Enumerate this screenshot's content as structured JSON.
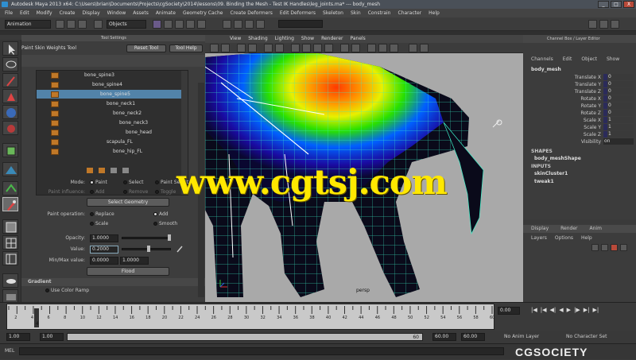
{
  "window": {
    "title": "Autodesk Maya 2013 x64: C:\\Users\\brian\\Documents\\Projects\\cgSociety\\2014\\lessons\\09. Binding the Mesh - Test IK Handles\\leg_joints.ma* --- body_mesh",
    "buttons": [
      "_",
      "□",
      "X"
    ]
  },
  "menubar": [
    "File",
    "Edit",
    "Modify",
    "Create",
    "Display",
    "Window",
    "Assets",
    "Animate",
    "Geometry Cache",
    "Create Deformers",
    "Edit Deformers",
    "Skeleton",
    "Skin",
    "Constrain",
    "Character",
    "Help"
  ],
  "shelf": {
    "mode": "Animation",
    "objects_combo": "Objects"
  },
  "tool_settings": {
    "header": "Tool Settings",
    "tool_name": "Paint Skin Weights Tool",
    "reset_button": "Reset Tool",
    "help_button": "Tool Help",
    "joints": [
      {
        "name": "bone_spine3",
        "indent": 60
      },
      {
        "name": "bone_spine4",
        "indent": 70
      },
      {
        "name": "bone_spine5",
        "indent": 80,
        "selected": true
      },
      {
        "name": "bone_neck1",
        "indent": 88
      },
      {
        "name": "bone_neck2",
        "indent": 96
      },
      {
        "name": "bone_neck3",
        "indent": 104
      },
      {
        "name": "bone_head",
        "indent": 112
      },
      {
        "name": "scapula_FL",
        "indent": 88
      },
      {
        "name": "bone_hip_FL",
        "indent": 96
      }
    ],
    "mode_label": "Mode:",
    "mode_options": [
      "Paint",
      "Select",
      "Paint Select"
    ],
    "paint_influence_label": "Paint influence:",
    "paint_influence_options": [
      "Add",
      "Remove",
      "Toggle"
    ],
    "select_geometry_button": "Select Geometry",
    "paint_operation_label": "Paint operation:",
    "paint_operations": [
      "Replace",
      "Add",
      "Scale",
      "Smooth"
    ],
    "opacity_label": "Opacity:",
    "opacity_value": "1.0000",
    "value_label": "Value:",
    "value_value": "0.2000",
    "minmax_label": "Min/Max value:",
    "min_value": "0.0000",
    "max_value": "1.0000",
    "flood_button": "Flood",
    "gradient_section": "Gradient",
    "use_color_ramp": "Use Color Ramp"
  },
  "viewport": {
    "menu": [
      "View",
      "Shading",
      "Lighting",
      "Show",
      "Renderer",
      "Panels"
    ],
    "camera_label": "persp"
  },
  "channel_box": {
    "header": "Channel Box / Layer Editor",
    "tabs": [
      "Channels",
      "Edit",
      "Object",
      "Show"
    ],
    "object_name": "body_mesh",
    "attributes": [
      {
        "name": "Translate X",
        "value": "0"
      },
      {
        "name": "Translate Y",
        "value": "0"
      },
      {
        "name": "Translate Z",
        "value": "0"
      },
      {
        "name": "Rotate X",
        "value": "0"
      },
      {
        "name": "Rotate Y",
        "value": "0"
      },
      {
        "name": "Rotate Z",
        "value": "0"
      },
      {
        "name": "Scale X",
        "value": "1"
      },
      {
        "name": "Scale Y",
        "value": "1"
      },
      {
        "name": "Scale Z",
        "value": "1"
      },
      {
        "name": "Visibility",
        "value": "on"
      }
    ],
    "shapes_header": "SHAPES",
    "shape_name": "body_meshShape",
    "inputs_header": "INPUTS",
    "inputs": [
      "skinCluster1",
      "tweak1"
    ]
  },
  "layer_editor": {
    "tabs": [
      "Display",
      "Render",
      "Anim"
    ],
    "menu": [
      "Layers",
      "Options",
      "Help"
    ]
  },
  "timeline": {
    "ticks": [
      "2",
      "4",
      "6",
      "8",
      "10",
      "12",
      "14",
      "16",
      "18",
      "20",
      "22",
      "24",
      "26",
      "28",
      "30",
      "32",
      "34",
      "36",
      "38",
      "40",
      "42",
      "44",
      "46",
      "48",
      "50",
      "52",
      "54",
      "56",
      "58",
      "60"
    ],
    "current_frame": "0.00",
    "current_marker": "4"
  },
  "range": {
    "start": "1.00",
    "inner_start": "1.00",
    "inner_end": "60.00",
    "end": "60.00",
    "end2": "60.00",
    "marker": "60",
    "anim_layer": "No Anim Layer",
    "character_set": "No Character Set"
  },
  "cmdline": {
    "label": "MEL"
  },
  "watermark": {
    "text": "www.cgtsj.com",
    "color": "#ffe800"
  },
  "brand_logo": {
    "text": "CGSOCIETY"
  }
}
